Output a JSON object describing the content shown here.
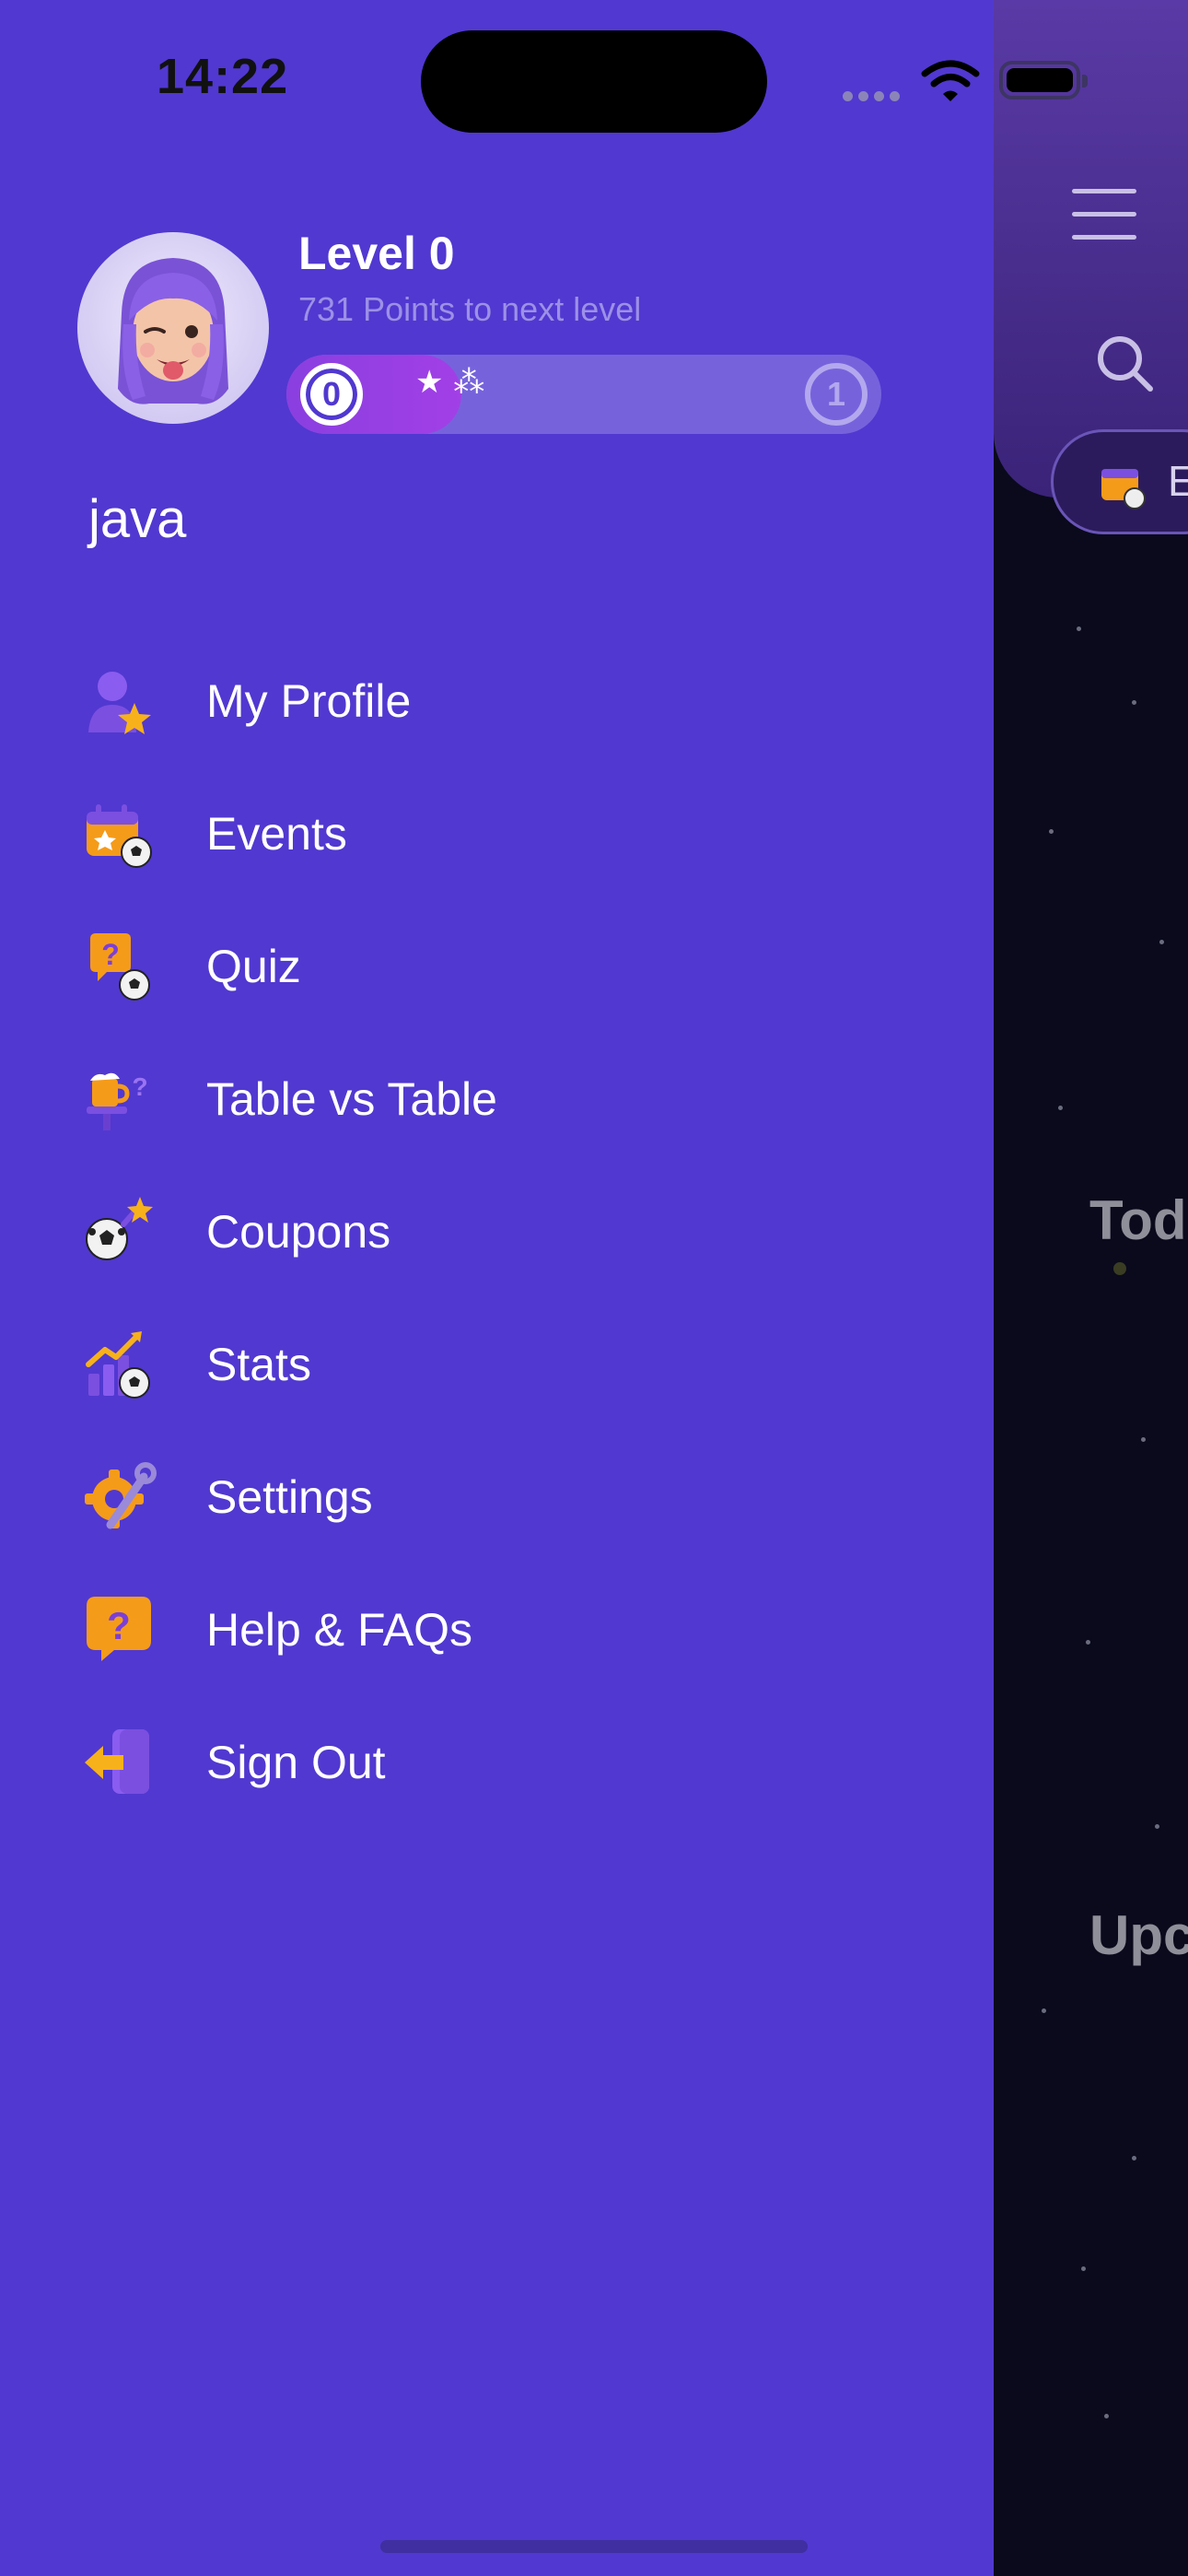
{
  "status_bar": {
    "time": "14:22"
  },
  "profile": {
    "level_title": "Level 0",
    "points_to_next": "731 Points to next level",
    "current_level": "0",
    "next_level": "1",
    "progress_fraction": 0.15,
    "username": "java"
  },
  "menu": {
    "items": [
      {
        "label": "My Profile",
        "icon": "profile-star-icon"
      },
      {
        "label": "Events",
        "icon": "calendar-ball-icon"
      },
      {
        "label": "Quiz",
        "icon": "question-ball-icon"
      },
      {
        "label": "Table vs Table",
        "icon": "beer-table-icon"
      },
      {
        "label": "Coupons",
        "icon": "ball-sparkle-icon"
      },
      {
        "label": "Stats",
        "icon": "chart-ball-icon"
      },
      {
        "label": "Settings",
        "icon": "gear-wrench-icon"
      },
      {
        "label": "Help & FAQs",
        "icon": "help-bubble-icon"
      },
      {
        "label": "Sign Out",
        "icon": "sign-out-icon"
      }
    ]
  },
  "background_app": {
    "chip_label": "E",
    "heading_today": "Tod",
    "heading_upcoming": "Upc"
  },
  "colors": {
    "drawer": "#5138d0",
    "progress_track": "#7663dc",
    "progress_fill": "#a23fe6",
    "accent_orange": "#f7a21b"
  }
}
